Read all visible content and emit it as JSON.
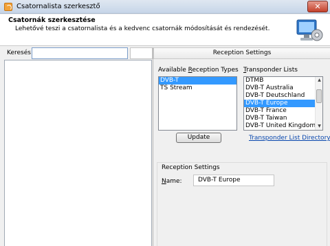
{
  "window": {
    "title": "Csatornalista szerkesztő",
    "close": "✕"
  },
  "header": {
    "title": "Csatornák szerkesztése",
    "description": "Lehetővé teszi a csatornalista és a kedvenc csatornák módosítását és rendezését."
  },
  "search": {
    "label": "Keresés",
    "value": ""
  },
  "right_panel": {
    "header": "Reception Settings",
    "available_label": "Available Reception Types",
    "transponder_label": "Transponder Lists",
    "available_items": [
      {
        "label": "DVB-T",
        "selected": true
      },
      {
        "label": "TS Stream",
        "selected": false
      }
    ],
    "transponder_items": [
      {
        "label": "DTMB",
        "selected": false
      },
      {
        "label": "DVB-T Australia",
        "selected": false
      },
      {
        "label": "DVB-T Deutschland",
        "selected": false
      },
      {
        "label": "DVB-T Europe",
        "selected": true
      },
      {
        "label": "DVB-T France",
        "selected": false
      },
      {
        "label": "DVB-T Taiwan",
        "selected": false
      },
      {
        "label": "DVB-T United Kingdom",
        "selected": false
      }
    ],
    "update_button": "Update",
    "directory_link": "Transponder List Directory",
    "settings_group": {
      "title": "Reception Settings",
      "name_label": "Name:",
      "name_value": "DVB-T Europe"
    }
  },
  "colors": {
    "selection": "#3399ff",
    "link": "#0645ad",
    "close_button": "#c5412b"
  },
  "icons": [
    "rss-app-icon",
    "monitor-settings-icon",
    "close-icon",
    "scroll-up-icon",
    "scroll-down-icon"
  ]
}
